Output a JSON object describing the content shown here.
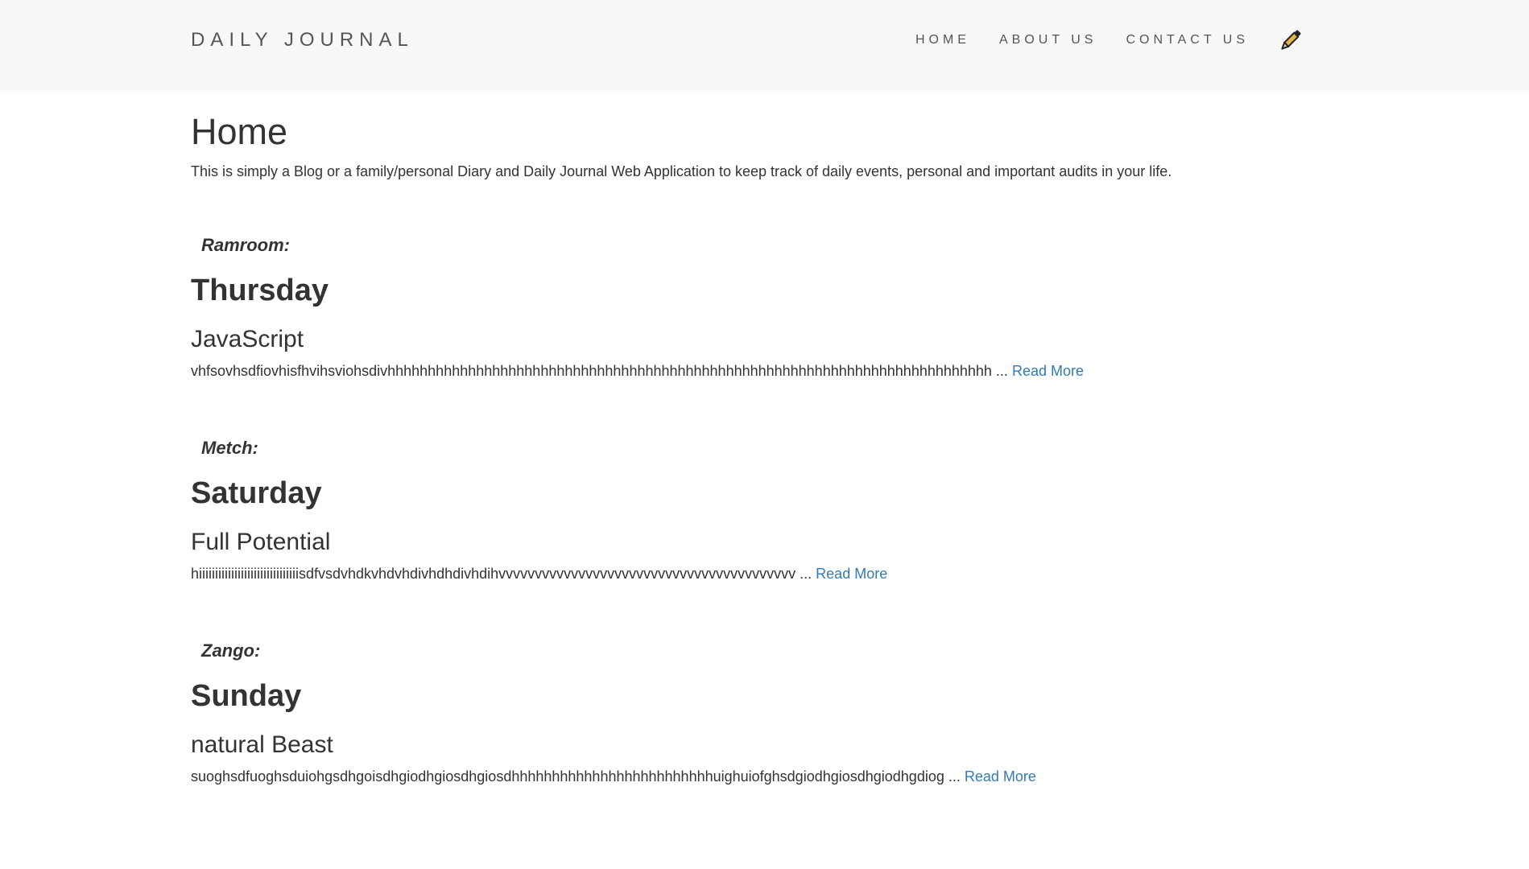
{
  "navbar": {
    "brand": "DAILY JOURNAL",
    "links": [
      {
        "label": "HOME"
      },
      {
        "label": "ABOUT US"
      },
      {
        "label": "CONTACT US"
      }
    ],
    "compose_icon": "pencil-icon"
  },
  "page": {
    "title": "Home",
    "intro": "This is simply a Blog or a family/personal Diary and Daily Journal Web Application to keep track of daily events, personal and important audits in your life."
  },
  "posts": [
    {
      "author": "Ramroom:",
      "day": "Thursday",
      "title": "JavaScript",
      "snippet": "vhfsovhsdfiovhisfhvihsviohsdivhhhhhhhhhhhhhhhhhhhhhhhhhhhhhhhhhhhhhhhhhhhhhhhhhhhhhhhhhhhhhhhhhhhhhhhhhhh ...",
      "read_more": "Read More"
    },
    {
      "author": "Metch:",
      "day": "Saturday",
      "title": "Full Potential",
      "snippet": "hiiiiiiiiiiiiiiiiiiiiiiiiiiiiiiisdfvsdvhdkvhdvhdivhdhdivhdihvvvvvvvvvvvvvvvvvvvvvvvvvvvvvvvvvvvvvvvvv ...",
      "read_more": "Read More"
    },
    {
      "author": "Zango:",
      "day": "Sunday",
      "title": "natural Beast",
      "snippet": "suoghsdfuoghsduiohgsdhgoisdhgiodhgiosdhgiosdhhhhhhhhhhhhhhhhhhhhhhhhhuighuiofghsdgiodhgiosdhgiodhgdiog ...",
      "read_more": "Read More"
    }
  ],
  "colors": {
    "navbar_bg": "#f8f8f8",
    "text": "#333333",
    "nav_text": "#555555",
    "link": "#337ab7"
  }
}
